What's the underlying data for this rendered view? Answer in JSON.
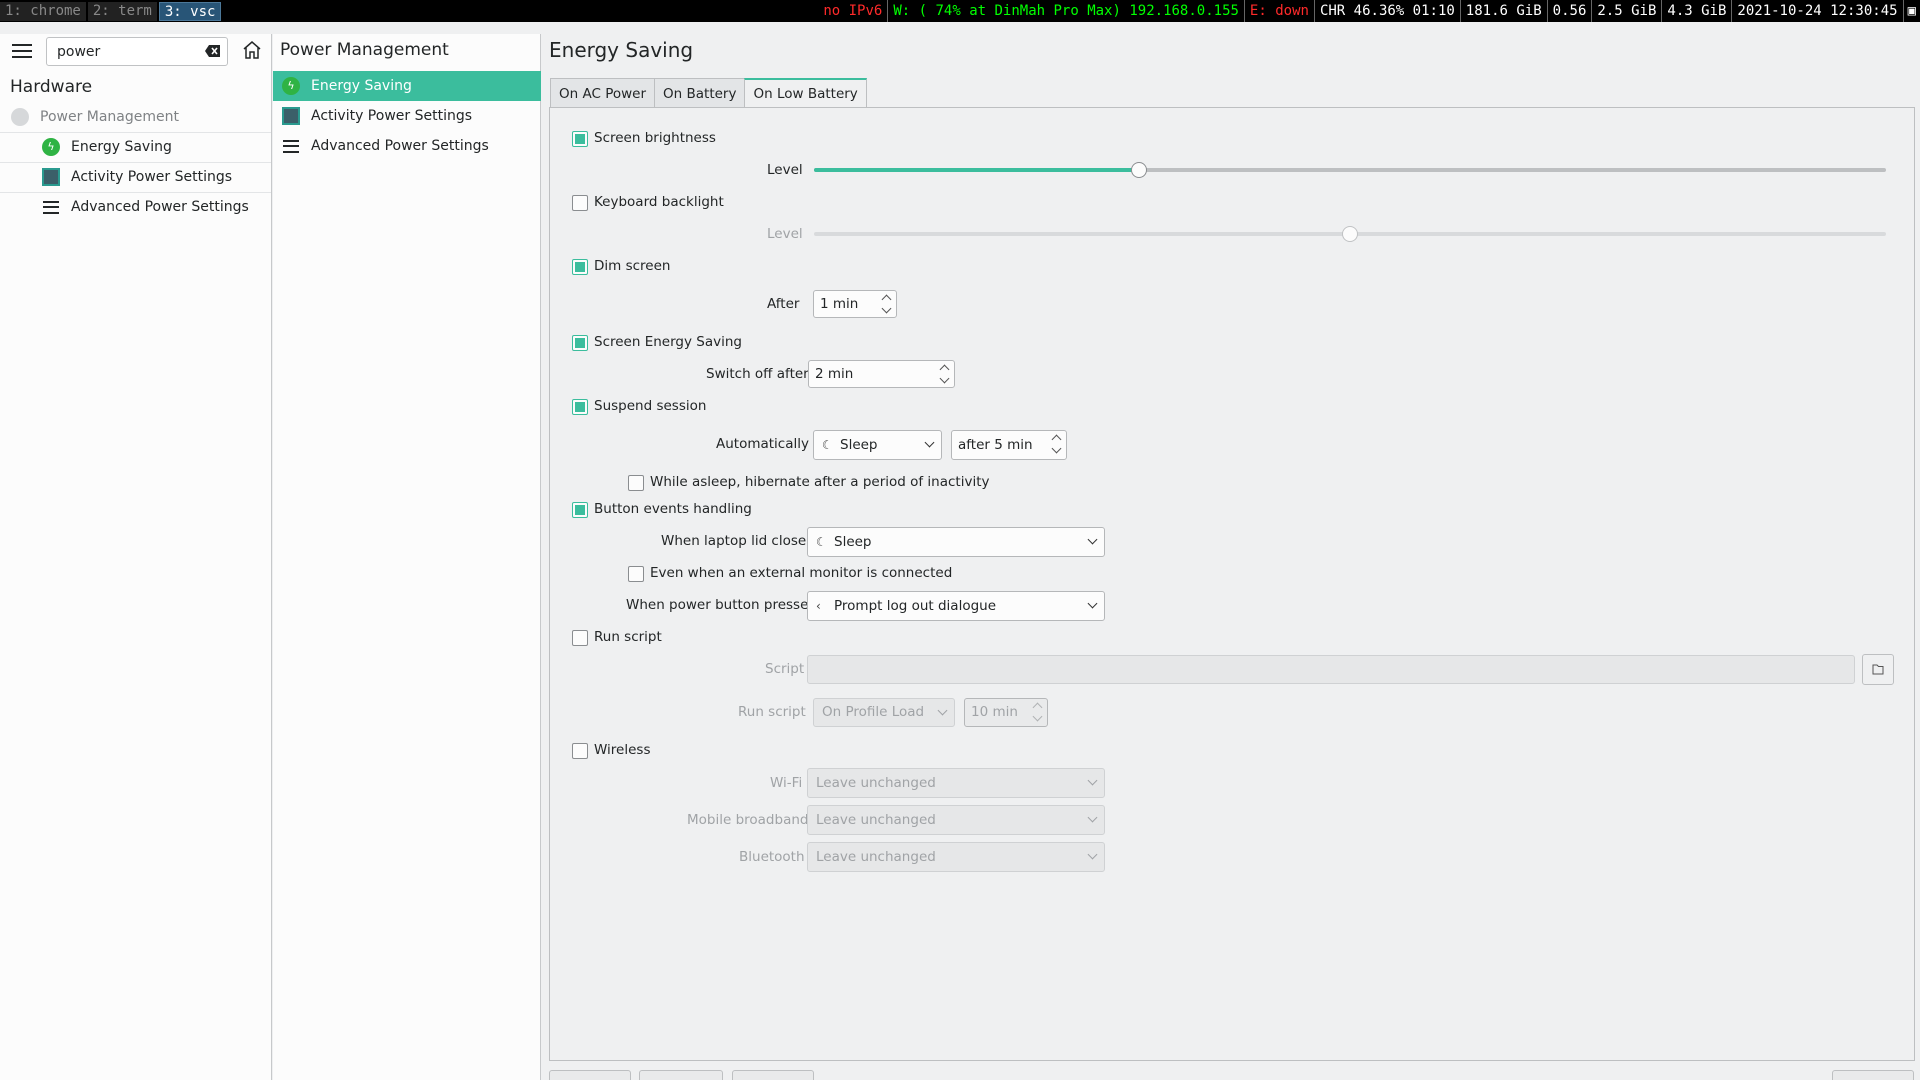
{
  "topbar": {
    "workspaces": [
      "1: chrome",
      "2: term",
      "3: vsc"
    ],
    "active_workspace": 2,
    "status": {
      "ipv6": "no IPv6",
      "wifi": "W: ( 74% at DinMah Pro Max) 192.168.0.155",
      "ethernet": "E: down",
      "battery": "CHR 46.36% 01:10",
      "disk": "181.6 GiB",
      "load": "0.56",
      "mem_used": "2.5 GiB",
      "mem_free": "4.3 GiB",
      "datetime": "2021-10-24 12:30:45"
    }
  },
  "search": {
    "value": "power"
  },
  "left": {
    "section": "Hardware",
    "category": "Power Management",
    "items": [
      "Energy Saving",
      "Activity Power Settings",
      "Advanced Power Settings"
    ]
  },
  "middle": {
    "title": "Power Management",
    "items": [
      "Energy Saving",
      "Activity Power Settings",
      "Advanced Power Settings"
    ],
    "selected_index": 0
  },
  "right": {
    "title": "Energy Saving",
    "tabs": [
      "On AC Power",
      "On Battery",
      "On Low Battery"
    ],
    "active_tab": 2,
    "screen_brightness": {
      "label": "Screen brightness",
      "checked": true,
      "level_label": "Level",
      "level": 0.3
    },
    "keyboard_backlight": {
      "label": "Keyboard backlight",
      "checked": false,
      "level_label": "Level",
      "level": 0.5
    },
    "dim_screen": {
      "label": "Dim screen",
      "checked": true,
      "after_label": "After",
      "value": "1 min"
    },
    "screen_energy_saving": {
      "label": "Screen Energy Saving",
      "checked": true,
      "switch_off_label": "Switch off after",
      "value": "2 min"
    },
    "suspend_session": {
      "label": "Suspend session",
      "checked": true,
      "auto_label": "Automatically",
      "action": "Sleep",
      "after": "after 5 min",
      "hibernate_label": "While asleep, hibernate after a period of inactivity",
      "hibernate_checked": false
    },
    "button_events": {
      "label": "Button events handling",
      "checked": true,
      "lid_label": "When laptop lid closed",
      "lid_value": "Sleep",
      "external_monitor_label": "Even when an external monitor is connected",
      "external_monitor_checked": false,
      "power_button_label": "When power button pressed",
      "power_button_value": "Prompt log out dialogue"
    },
    "run_script": {
      "label": "Run script",
      "checked": false,
      "script_label": "Script",
      "script_value": "",
      "run_label": "Run script",
      "run_value": "On Profile Load",
      "delay": "10 min"
    },
    "wireless": {
      "label": "Wireless",
      "checked": false,
      "wifi_label": "Wi-Fi",
      "wifi_value": "Leave unchanged",
      "mobile_label": "Mobile broadband",
      "mobile_value": "Leave unchanged",
      "bluetooth_label": "Bluetooth",
      "bluetooth_value": "Leave unchanged"
    }
  },
  "colors": {
    "accent": "#3bbd9d"
  }
}
